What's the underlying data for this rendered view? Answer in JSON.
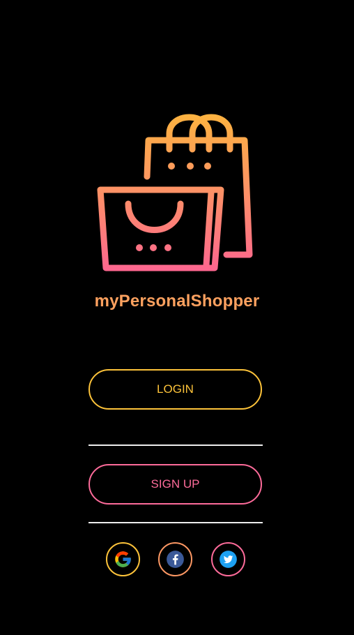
{
  "app": {
    "name": "myPersonalShopper",
    "logo_icon": "shopping-bags-icon"
  },
  "actions": {
    "login_label": "LOGIN",
    "signup_label": "SIGN UP"
  },
  "social_login": [
    {
      "provider": "google",
      "icon": "google-icon"
    },
    {
      "provider": "facebook",
      "icon": "facebook-icon"
    },
    {
      "provider": "twitter",
      "icon": "twitter-icon"
    }
  ],
  "colors": {
    "background": "#000000",
    "gradient_top": "#FDC33A",
    "gradient_mid": "#FD9864",
    "gradient_bottom": "#FD6B9A",
    "divider": "#EDEDED",
    "facebook": "#3B5998",
    "twitter": "#1DA1F2"
  }
}
